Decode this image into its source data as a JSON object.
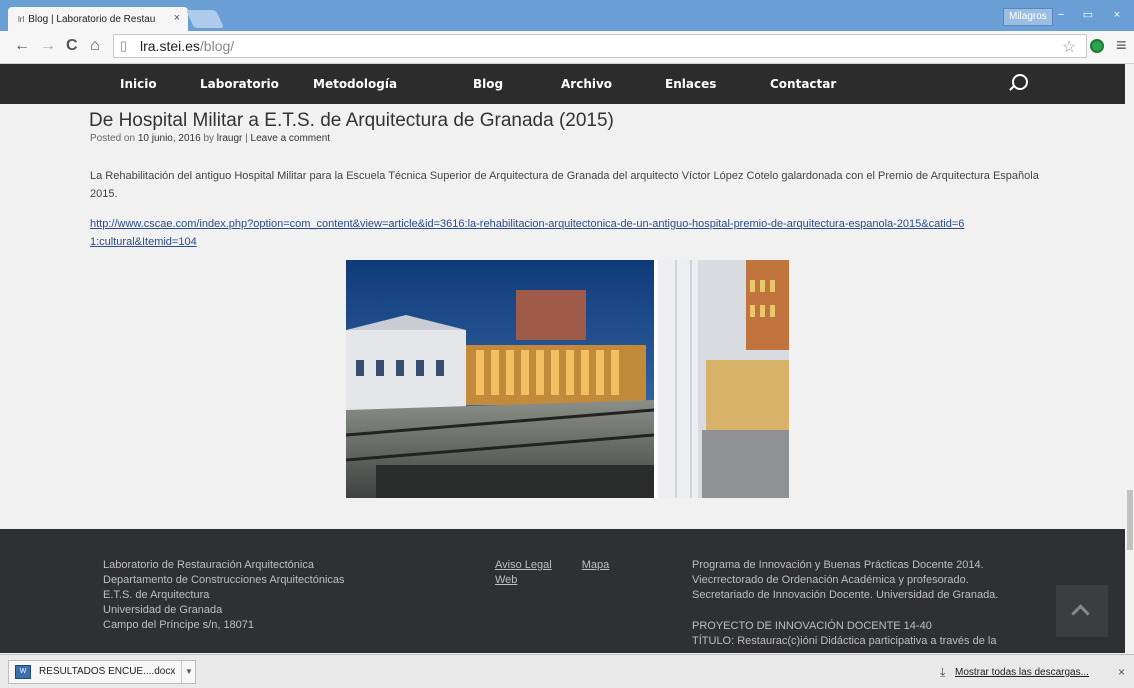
{
  "browser": {
    "tab_title": "Blog | Laboratorio de Restau",
    "tab_favicon_text": "lrl",
    "tab_close": "×",
    "user_name": "Milagros",
    "win_min": "−",
    "win_max": "▭",
    "win_close": "×",
    "url_host": "lra.stei.es",
    "url_path": "/blog/"
  },
  "nav": {
    "items": [
      "Inicio",
      "Laboratorio",
      "Metodología",
      "Blog",
      "Archivo",
      "Enlaces",
      "Contactar"
    ]
  },
  "post": {
    "title": "De Hospital Militar a E.T.S. de Arquitectura de Granada (2015)",
    "posted_on": "Posted on",
    "date": "10 junio, 2016",
    "by": "by",
    "author": "lraugr",
    "separator": "|",
    "comment_link": "Leave a comment",
    "body": "La Rehabilitación del antiguo Hospital Militar para la Escuela Técnica Superior de Arquitectura de Granada del arquitecto Víctor López Cotelo galardonada con el Premio de Arquitectura Española 2015.",
    "link": "http://www.cscae.com/index.php?option=com_content&view=article&id=3616:la-rehabilitacion-arquitectonica-de-un-antiguo-hospital-premio-de-arquitectura-espanola-2015&catid=61:cultural&Itemid=104"
  },
  "footer": {
    "address": [
      "Laboratorio de Restauración Arquitectónica",
      "Departamento de Construcciones Arquitectónicas",
      "E.T.S. de Arquitectura",
      "Universidad de Granada",
      "Campo del Príncipe s/n, 18071"
    ],
    "links": {
      "aviso_legal": "Aviso Legal",
      "mapa": "Mapa",
      "web": "Web"
    },
    "program": [
      "Programa de Innovación y Buenas Prácticas Docente 2014.",
      "Viecrrectorado de Ordenación Académica y profesorado.",
      "Secretariado de Innovación Docente. Universidad de Granada."
    ],
    "project": [
      "PROYECTO DE INNOVACIÓN DOCENTE 14-40",
      "TÍTULO: Restaurac(c)ióni Didáctica participativa a través de la"
    ]
  },
  "downloads": {
    "file_name": "RESULTADOS ENCUE....docx",
    "file_icon_text": "W",
    "show_all": "Mostrar todas las descargas...",
    "close": "×"
  },
  "colors": {
    "nav_bg": "#2c2c2c",
    "footer_bg": "#2f3033",
    "link": "#2a4d8a"
  }
}
